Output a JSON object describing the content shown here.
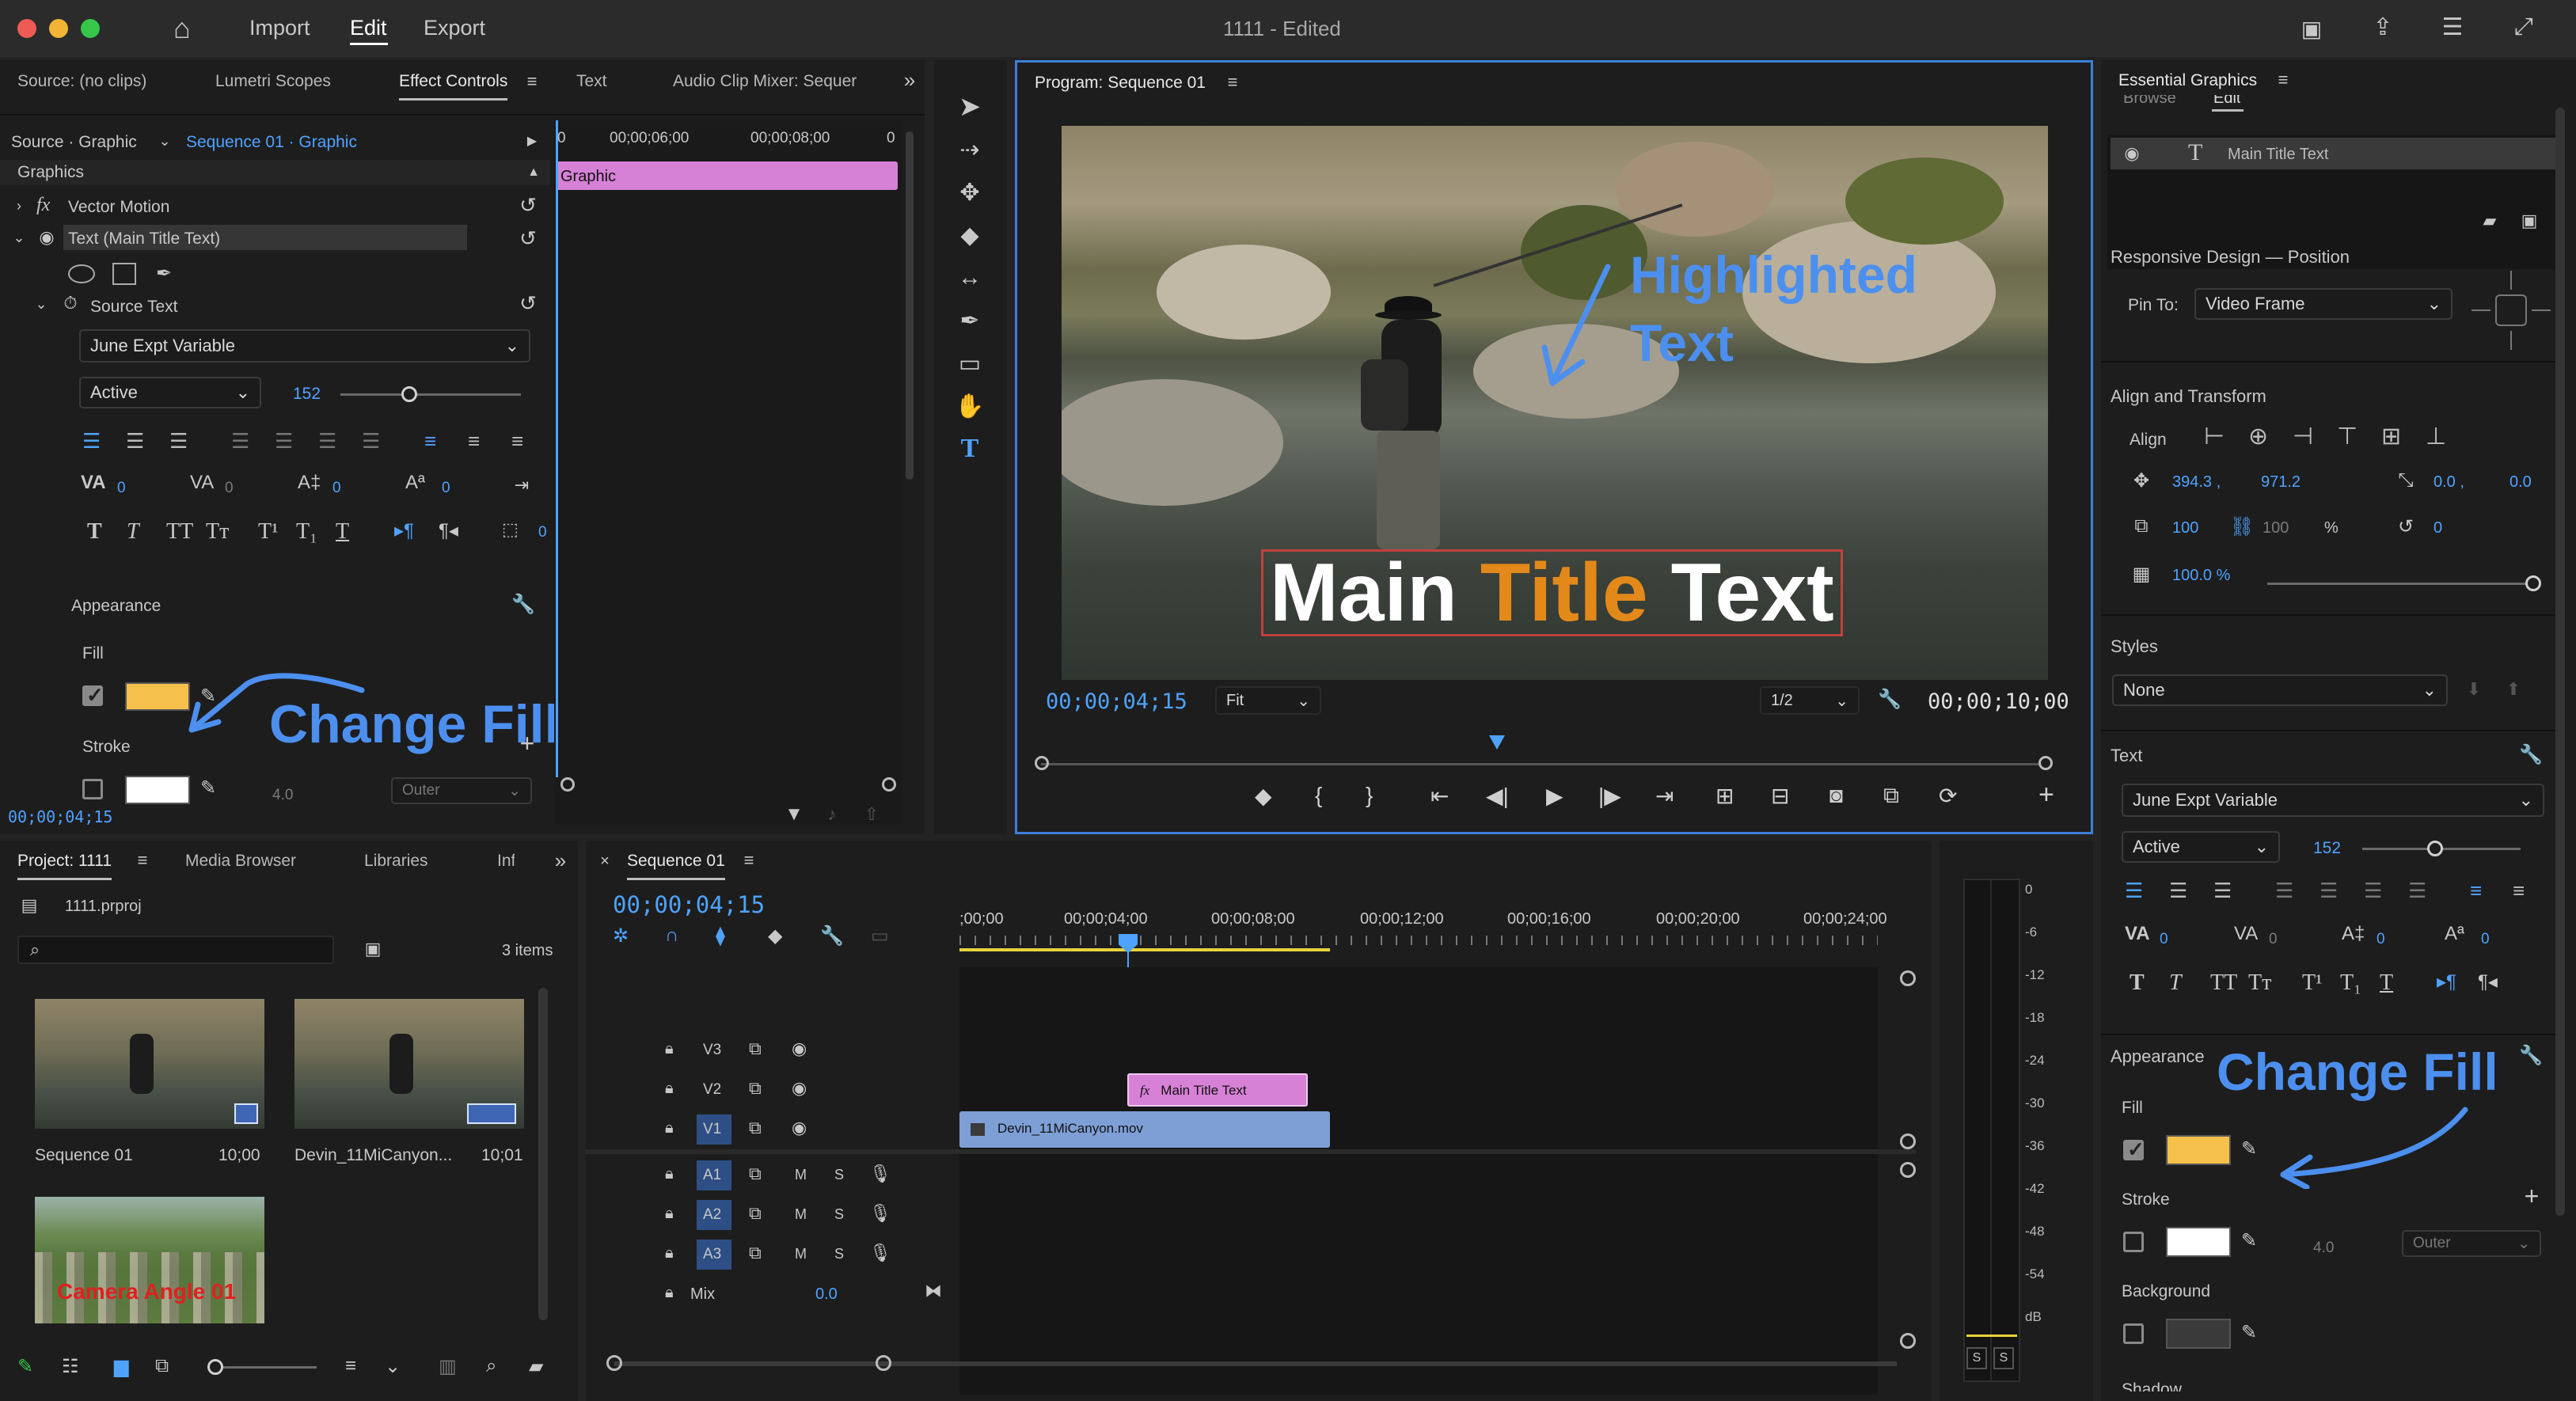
{
  "topbar": {
    "nav": [
      "Import",
      "Edit",
      "Export"
    ],
    "active_nav": "Edit",
    "doc_title": "1111 - Edited"
  },
  "source_panel": {
    "tabs": [
      "Source: (no clips)",
      "Lumetri Scopes",
      "Effect Controls",
      "Text",
      "Audio Clip Mixer: Sequer"
    ],
    "active_tab": "Effect Controls",
    "source_label": "Source · Graphic",
    "sequence_label": "Sequence 01 · Graphic",
    "ruler": [
      "00;00;06;00",
      "00;00;08;00",
      "0"
    ],
    "ruler_first": "0",
    "clip_label": "Graphic",
    "section_graphics": "Graphics",
    "vector_motion": "Vector Motion",
    "text_layer": "Text (Main Title Text)",
    "source_text": "Source Text",
    "font": "June Expt Variable",
    "font_style": "Active",
    "font_size": "152",
    "tracking_values": [
      "0",
      "0",
      "0",
      "0",
      "0"
    ],
    "appearance": "Appearance",
    "fill": "Fill",
    "stroke": "Stroke",
    "stroke_width": "4.0",
    "stroke_type": "Outer",
    "timecode": "00;00;04;15",
    "fill_color": "#f6c14b",
    "callout": "Change Fill"
  },
  "program": {
    "title": "Program: Sequence 01",
    "overlay_main": [
      "Main ",
      "Title",
      " Text"
    ],
    "overlay_highlight": [
      "Highlighted",
      "Text"
    ],
    "timecode": "00;00;04;15",
    "zoom": "Fit",
    "resolution": "1/2",
    "duration": "00;00;10;00"
  },
  "project": {
    "tabs": [
      "Project: 1111",
      "Media Browser",
      "Libraries",
      "Inf"
    ],
    "file": "1111.prproj",
    "count": "3 items",
    "items": [
      {
        "name": "Sequence 01",
        "duration": "10;00"
      },
      {
        "name": "Devin_11MiCanyon...",
        "duration": "10;01"
      },
      {
        "name": "",
        "duration": "",
        "overlay": "Camera Angle 01"
      }
    ]
  },
  "timeline": {
    "tab": "Sequence 01",
    "timecode": "00;00;04;15",
    "ruler": [
      ";00;00",
      "00;00;04;00",
      "00;00;08;00",
      "00;00;12;00",
      "00;00;16;00",
      "00;00;20;00",
      "00;00;24;00"
    ],
    "video_tracks": [
      "V3",
      "V2",
      "V1"
    ],
    "audio_tracks": [
      "A1",
      "A2",
      "A3"
    ],
    "mix_label": "Mix",
    "mix_value": "0.0",
    "clip_graphic": "Main Title Text",
    "clip_video": "Devin_11MiCanyon.mov",
    "meter_scale": [
      "0",
      "-6",
      "-12",
      "-18",
      "-24",
      "-30",
      "-36",
      "-42",
      "-48",
      "-54",
      "dB"
    ]
  },
  "essential_graphics": {
    "title": "Essential Graphics",
    "tabs": [
      "Browse",
      "Edit"
    ],
    "layer": "Main Title Text",
    "responsive_design": "Responsive Design — Position",
    "pin_to_label": "Pin To:",
    "pin_to_value": "Video Frame",
    "align_transform": "Align and Transform",
    "align": "Align",
    "pos_x": "394.3 ,",
    "pos_y": "971.2",
    "anchor_x": "0.0 ,",
    "anchor_y": "0.0",
    "scale": "100",
    "scale_h": "100",
    "scale_unit": "%",
    "rotation": "0",
    "opacity": "100.0 %",
    "styles": "Styles",
    "style_value": "None",
    "text_section": "Text",
    "font": "June Expt Variable",
    "font_style": "Active",
    "font_size": "152",
    "tracking_values": [
      "0",
      "0",
      "0",
      "0"
    ],
    "appearance": "Appearance",
    "fill": "Fill",
    "stroke": "Stroke",
    "stroke_width": "4.0",
    "stroke_type": "Outer",
    "background": "Background",
    "shadow": "Shadow",
    "fill_color": "#f6c14b",
    "callout": "Change Fill"
  },
  "colors": {
    "accent": "#4fa3ff",
    "clip_pink": "#d681d6",
    "clip_blue": "#7e9fd6",
    "callout_blue": "#4c8fef"
  }
}
